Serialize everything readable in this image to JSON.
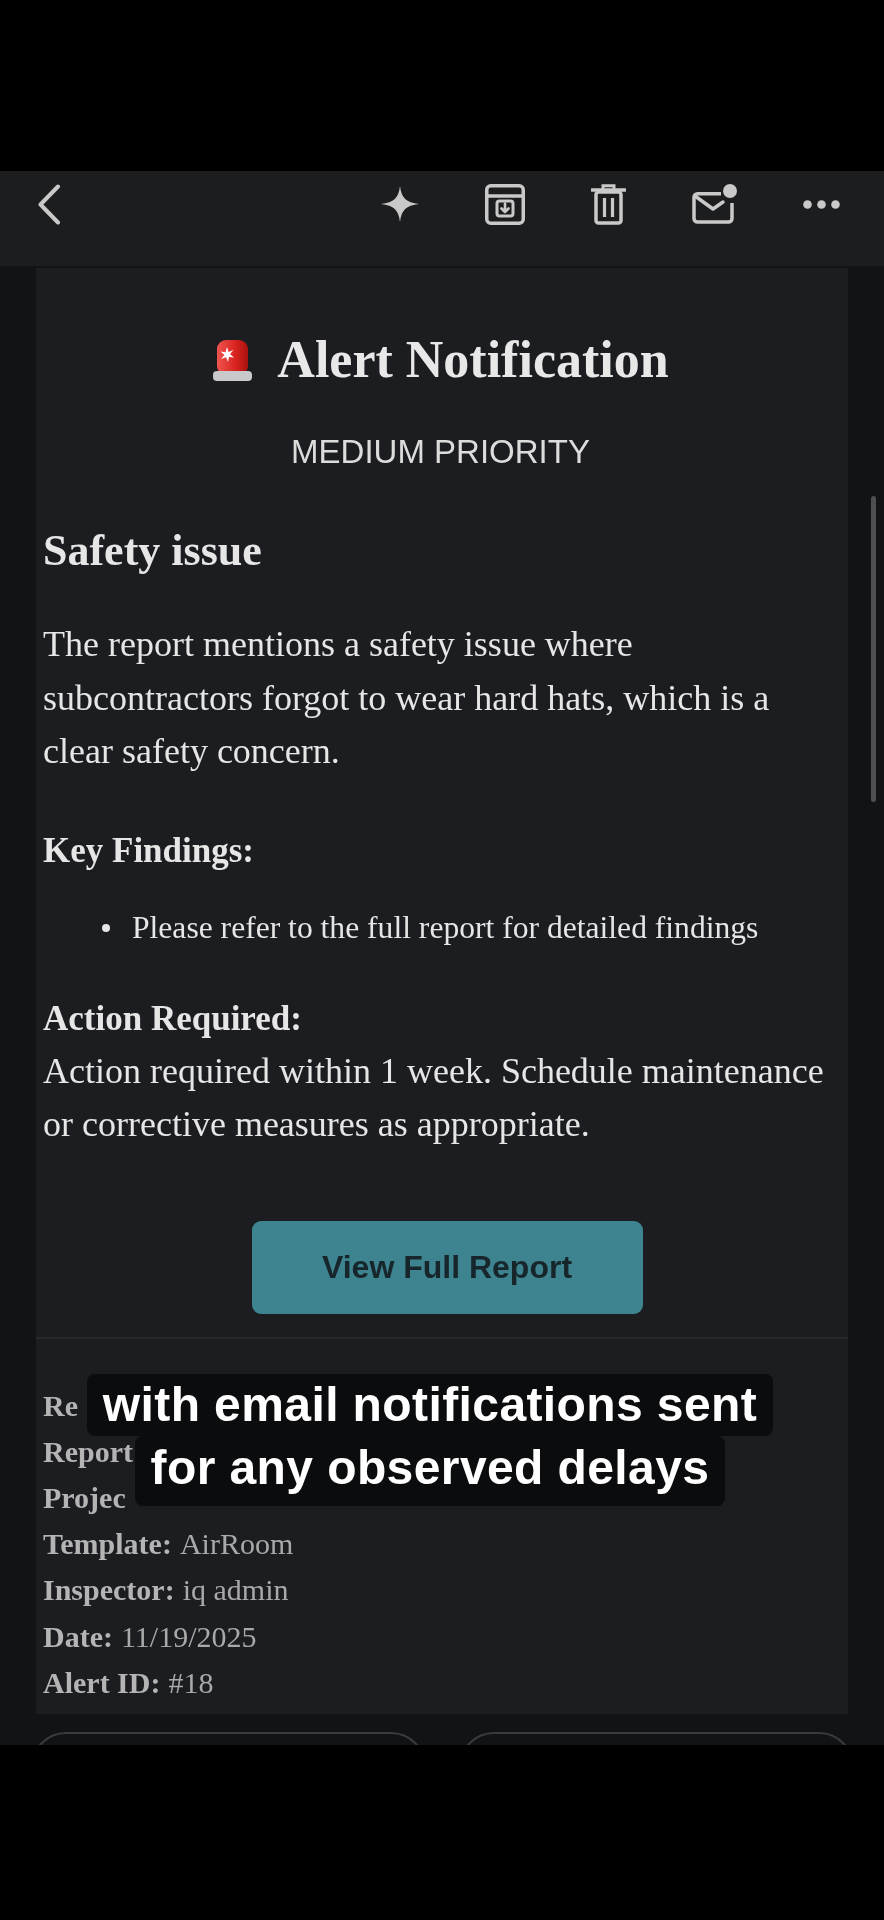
{
  "alert": {
    "title": "Alert Notification",
    "priority": "MEDIUM PRIORITY"
  },
  "issue": {
    "heading": "Safety issue",
    "summary": "The report mentions a safety issue where subcontractors forgot to wear hard hats, which is a clear safety concern."
  },
  "key_findings": {
    "heading": "Key Findings:",
    "items": [
      "Please refer to the full report for detailed findings"
    ]
  },
  "action_required": {
    "heading": "Action Required:",
    "text": "Action required within 1 week. Schedule maintenance or corrective measures as appropriate."
  },
  "button": {
    "label": "View Full Report"
  },
  "details": [
    {
      "label": "Re"
    },
    {
      "label": "Report"
    },
    {
      "label": "Projec"
    },
    {
      "label": "Template:",
      "value": "AirRoom"
    },
    {
      "label": "Inspector:",
      "value": "iq admin"
    },
    {
      "label": "Date:",
      "value": "11/19/2025"
    },
    {
      "label": "Alert ID:",
      "value": "#18"
    }
  ],
  "caption": {
    "lines": [
      "with email notifications sent",
      "for any observed delays"
    ]
  }
}
